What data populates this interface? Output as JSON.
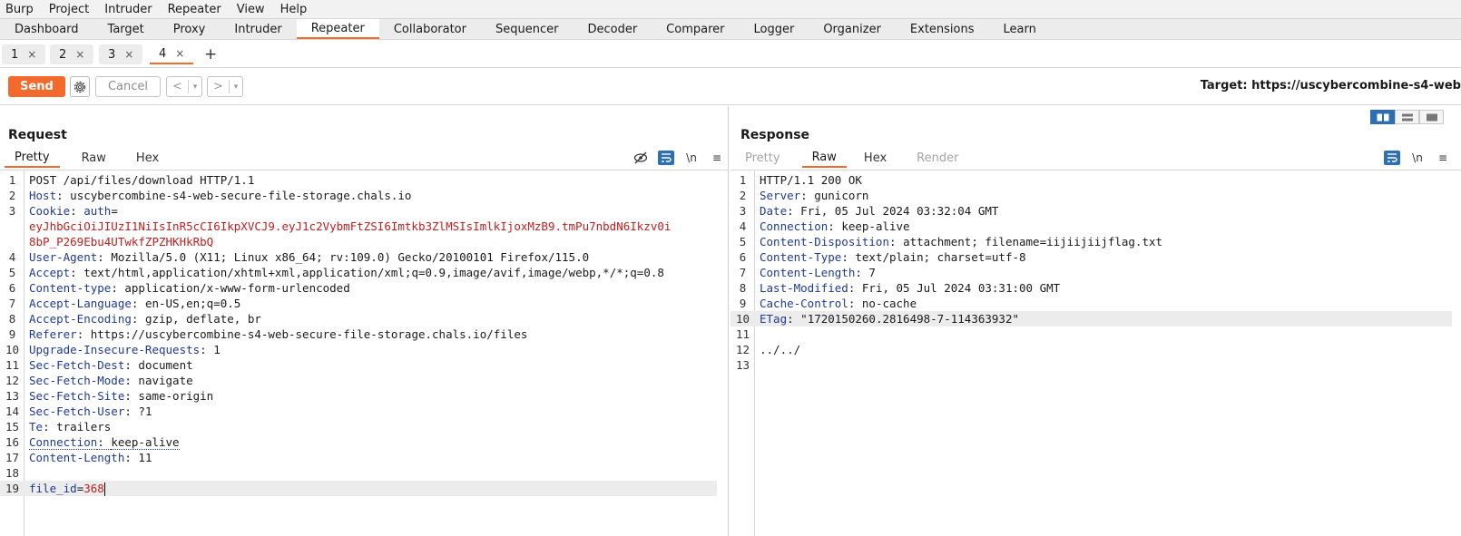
{
  "menu": [
    "Burp",
    "Project",
    "Intruder",
    "Repeater",
    "View",
    "Help"
  ],
  "main_tabs": [
    "Dashboard",
    "Target",
    "Proxy",
    "Intruder",
    "Repeater",
    "Collaborator",
    "Sequencer",
    "Decoder",
    "Comparer",
    "Logger",
    "Organizer",
    "Extensions",
    "Learn"
  ],
  "repeater_tabs": [
    "1",
    "2",
    "3",
    "4"
  ],
  "close_glyph": "×",
  "add_tab": "+",
  "toolbar": {
    "send": "Send",
    "cancel": "Cancel",
    "back": "<",
    "forward": ">",
    "dropdown": "▾",
    "target": "Target: https://uscybercombine-s4-web"
  },
  "request": {
    "title": "Request",
    "tabs": [
      "Pretty",
      "Raw",
      "Hex"
    ],
    "tools": [
      "\\n",
      "≡"
    ],
    "lines": [
      {
        "n": "1",
        "name": "",
        "sep": "",
        "value": "POST /api/files/download HTTP/1.1"
      },
      {
        "n": "2",
        "name": "Host",
        "sep": ": ",
        "value": "uscybercombine-s4-web-secure-file-storage.chals.io"
      },
      {
        "n": "3",
        "name": "Cookie",
        "sep": ": ",
        "value": "",
        "cookie_name": "auth",
        "cookie_eq": "=",
        "cookie_value_1": "eyJhbGciOiJIUzI1NiIsInR5cCI6IkpXVCJ9.eyJ1c2VybmFtZSI6Imtkb3ZlMSIsImlkIjoxMzB9.tmPu7nbdN6Ikzv0i",
        "cookie_value_2": "8bP_P269Ebu4UTwkfZPZHKHkRbQ"
      },
      {
        "n": "4",
        "name": "User-Agent",
        "sep": ": ",
        "value": "Mozilla/5.0 (X11; Linux x86_64; rv:109.0) Gecko/20100101 Firefox/115.0"
      },
      {
        "n": "5",
        "name": "Accept",
        "sep": ": ",
        "value": "text/html,application/xhtml+xml,application/xml;q=0.9,image/avif,image/webp,*/*;q=0.8"
      },
      {
        "n": "6",
        "name": "Content-type",
        "sep": ": ",
        "value": "application/x-www-form-urlencoded"
      },
      {
        "n": "7",
        "name": "Accept-Language",
        "sep": ": ",
        "value": "en-US,en;q=0.5"
      },
      {
        "n": "8",
        "name": "Accept-Encoding",
        "sep": ": ",
        "value": "gzip, deflate, br"
      },
      {
        "n": "9",
        "name": "Referer",
        "sep": ": ",
        "value": "https://uscybercombine-s4-web-secure-file-storage.chals.io/files"
      },
      {
        "n": "10",
        "name": "Upgrade-Insecure-Requests",
        "sep": ": ",
        "value": "1"
      },
      {
        "n": "11",
        "name": "Sec-Fetch-Dest",
        "sep": ": ",
        "value": "document"
      },
      {
        "n": "12",
        "name": "Sec-Fetch-Mode",
        "sep": ": ",
        "value": "navigate"
      },
      {
        "n": "13",
        "name": "Sec-Fetch-Site",
        "sep": ": ",
        "value": "same-origin"
      },
      {
        "n": "14",
        "name": "Sec-Fetch-User",
        "sep": ": ",
        "value": "?1"
      },
      {
        "n": "15",
        "name": "Te",
        "sep": ": ",
        "value": "trailers"
      },
      {
        "n": "16",
        "name": "Connection",
        "sep": ": ",
        "value": "keep-alive"
      },
      {
        "n": "17",
        "name": "Content-Length",
        "sep": ": ",
        "value": "11"
      },
      {
        "n": "18",
        "name": "",
        "sep": "",
        "value": ""
      },
      {
        "n": "19",
        "name": "file_id",
        "sep": "=",
        "value": "368"
      }
    ]
  },
  "response": {
    "title": "Response",
    "tabs": [
      "Pretty",
      "Raw",
      "Hex",
      "Render"
    ],
    "tools": [
      "\\n",
      "≡"
    ],
    "lines": [
      {
        "n": "1",
        "name": "",
        "sep": "",
        "value": "HTTP/1.1 200 OK"
      },
      {
        "n": "2",
        "name": "Server",
        "sep": ": ",
        "value": "gunicorn"
      },
      {
        "n": "3",
        "name": "Date",
        "sep": ": ",
        "value": "Fri, 05 Jul 2024 03:32:04 GMT"
      },
      {
        "n": "4",
        "name": "Connection",
        "sep": ": ",
        "value": "keep-alive"
      },
      {
        "n": "5",
        "name": "Content-Disposition",
        "sep": ": ",
        "value": "attachment; filename=iijiijiijflag.txt"
      },
      {
        "n": "6",
        "name": "Content-Type",
        "sep": ": ",
        "value": "text/plain; charset=utf-8"
      },
      {
        "n": "7",
        "name": "Content-Length",
        "sep": ": ",
        "value": "7"
      },
      {
        "n": "8",
        "name": "Last-Modified",
        "sep": ": ",
        "value": "Fri, 05 Jul 2024 03:31:00 GMT"
      },
      {
        "n": "9",
        "name": "Cache-Control",
        "sep": ": ",
        "value": "no-cache"
      },
      {
        "n": "10",
        "name": "ETag",
        "sep": ": ",
        "value": "\"1720150260.2816498-7-114363932\""
      },
      {
        "n": "11",
        "name": "",
        "sep": "",
        "value": ""
      },
      {
        "n": "12",
        "name": "",
        "sep": "",
        "value": "../../"
      },
      {
        "n": "13",
        "name": "",
        "sep": "",
        "value": ""
      }
    ]
  },
  "colors": {
    "accent": "#f26b2d",
    "header_name": "#1f3a93",
    "cookie_value": "#c41d1d",
    "toggle_on": "#2c6fb3"
  }
}
